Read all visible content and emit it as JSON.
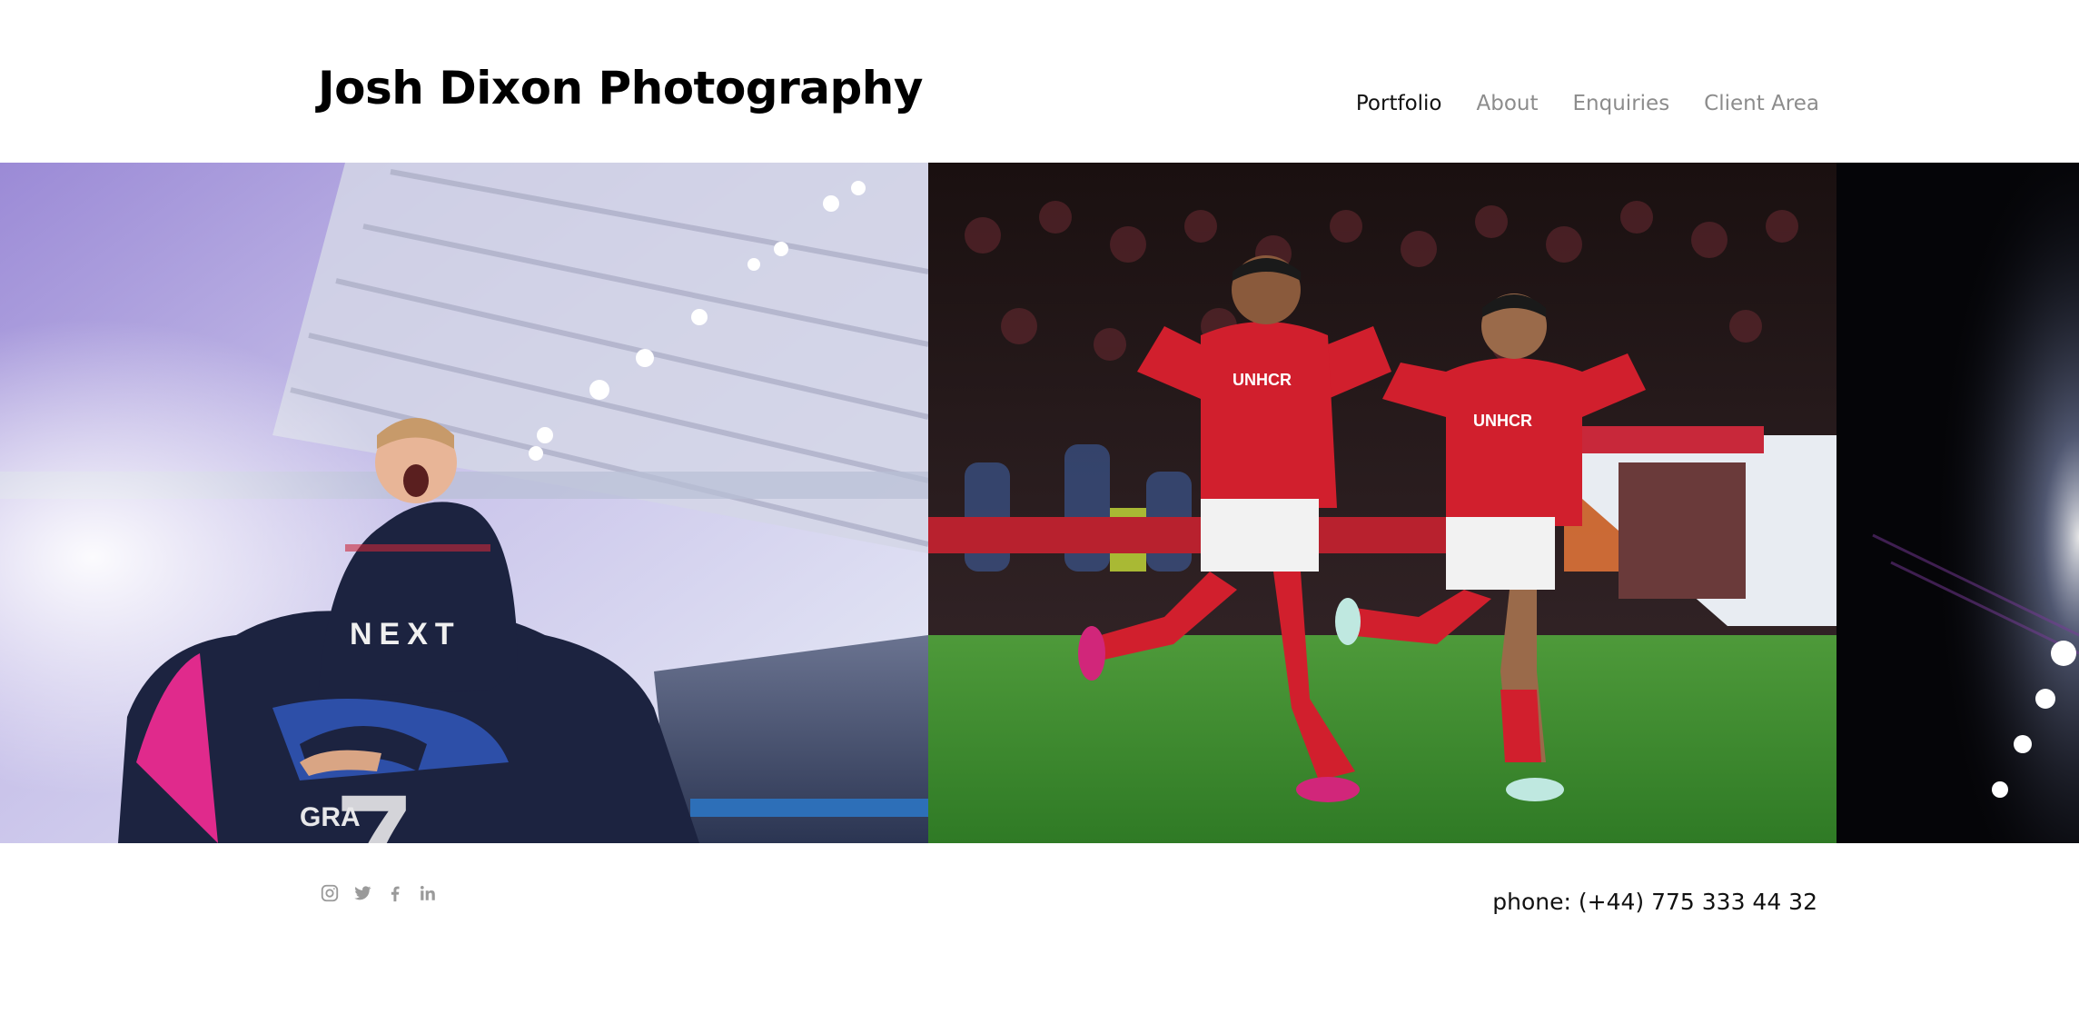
{
  "site": {
    "title": "Josh Dixon Photography"
  },
  "nav": {
    "items": [
      {
        "label": "Portfolio",
        "active": true
      },
      {
        "label": "About",
        "active": false
      },
      {
        "label": "Enquiries",
        "active": false
      },
      {
        "label": "Client Area",
        "active": false
      }
    ]
  },
  "gallery": {
    "photos": [
      {
        "subject": "players-group-celebration-photo"
      },
      {
        "subject": "two-players-celebrating-photo"
      },
      {
        "subject": "floodlights-night-photo"
      }
    ]
  },
  "footer": {
    "social_icons": [
      "instagram-icon",
      "twitter-icon",
      "facebook-icon",
      "linkedin-icon"
    ],
    "phone": "phone: (+44) 775 333 44 32"
  },
  "colors": {
    "nav_active": "#111111",
    "nav_inactive": "#8c8c8c",
    "icon_gray": "#9a9a9a",
    "kit_red": "#d11f2d",
    "kit_navy": "#1c2340"
  }
}
